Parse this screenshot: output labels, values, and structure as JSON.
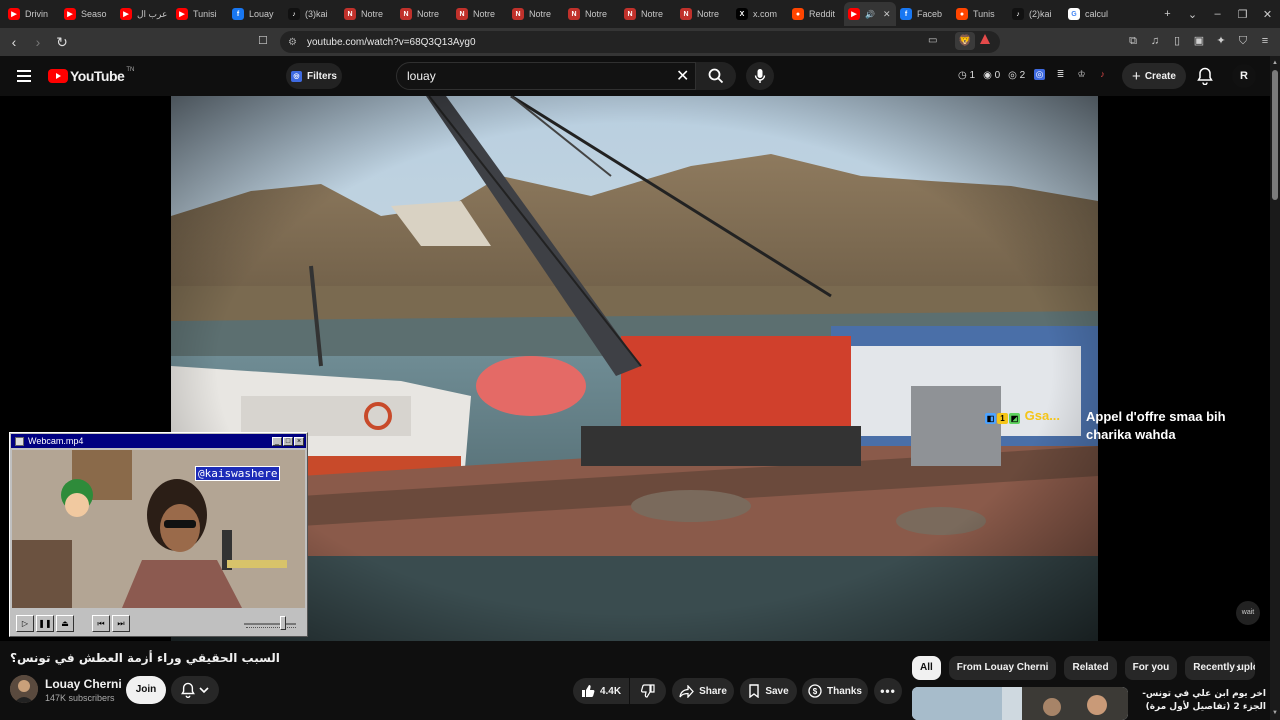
{
  "browser": {
    "tabs": [
      {
        "title": "Drivin",
        "favicon": "youtube"
      },
      {
        "title": "Seaso",
        "favicon": "youtube"
      },
      {
        "title": "عرب ال",
        "favicon": "youtube"
      },
      {
        "title": "Tunisi",
        "favicon": "youtube"
      },
      {
        "title": "Louay",
        "favicon": "facebook"
      },
      {
        "title": "(3)kai",
        "favicon": "tiktok"
      },
      {
        "title": "Notre",
        "favicon": "notre"
      },
      {
        "title": "Notre",
        "favicon": "notre"
      },
      {
        "title": "Notre",
        "favicon": "notre"
      },
      {
        "title": "Notre",
        "favicon": "notre"
      },
      {
        "title": "Notre",
        "favicon": "notre"
      },
      {
        "title": "Notre",
        "favicon": "notre"
      },
      {
        "title": "Notre",
        "favicon": "notre"
      },
      {
        "title": "x.com",
        "favicon": "x"
      },
      {
        "title": "Reddit",
        "favicon": "reddit"
      },
      {
        "title": "",
        "favicon": "youtube",
        "active": true
      },
      {
        "title": "Faceb",
        "favicon": "facebook"
      },
      {
        "title": "Tunis",
        "favicon": "reddit"
      },
      {
        "title": "(2)kai",
        "favicon": "tiktok"
      },
      {
        "title": "calcul",
        "favicon": "google"
      }
    ],
    "url": "youtube.com/watch?v=68Q3Q13Ayg0"
  },
  "youtube": {
    "logo_text": "YouTube",
    "logo_sup": "TN",
    "filters_label": "Filters",
    "search_value": "louay",
    "counters": [
      "1",
      "0",
      "2"
    ],
    "create_label": "Create",
    "avatar_letter": "R"
  },
  "overlay": {
    "user_name": "Gsa...",
    "badge_1": "1",
    "message": "Appel d'offre smaa bih charika wahda",
    "watermark": "wait"
  },
  "webcam": {
    "title": "Webcam.mp4",
    "tag": "@kaiswashere"
  },
  "video": {
    "title": "السبب الحقيقي وراء أزمة العطش في تونس؟",
    "channel": "Louay Cherni",
    "subscribers": "147K subscribers",
    "join_label": "Join",
    "likes": "4.4K",
    "share_label": "Share",
    "save_label": "Save",
    "thanks_label": "Thanks"
  },
  "recommendations": {
    "chips": [
      "All",
      "From Louay Cherni",
      "Related",
      "For you",
      "Recently uploaded"
    ],
    "first_title": "اخر يوم ابن علي في تونس- الجزء 2 (تفاصيل لأول مرة)"
  }
}
